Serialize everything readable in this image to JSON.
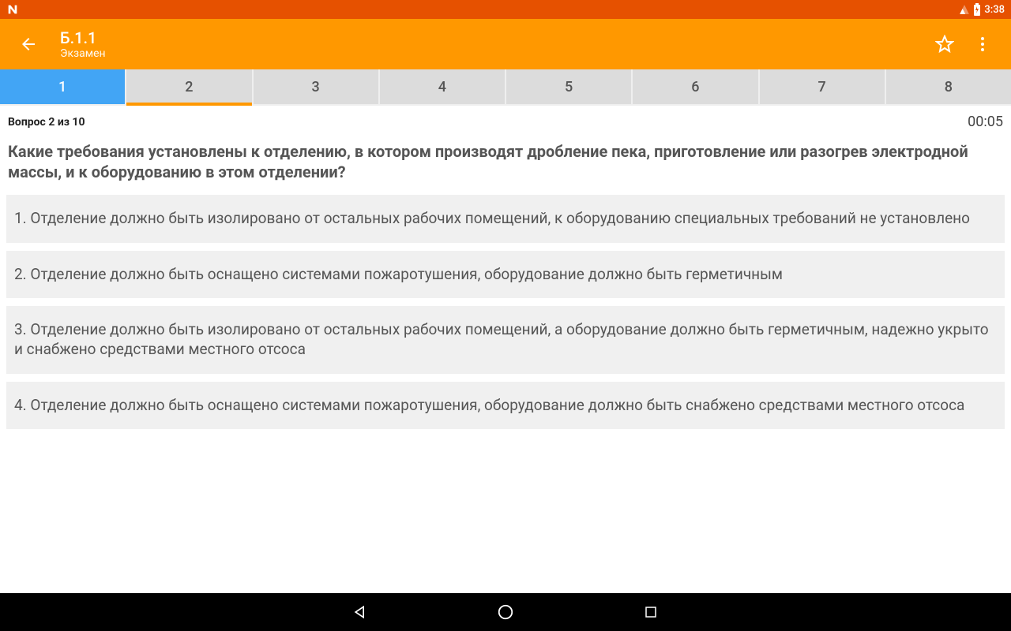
{
  "status": {
    "clock": "3:38"
  },
  "appbar": {
    "title": "Б.1.1",
    "subtitle": "Экзамен"
  },
  "tabs": [
    {
      "label": "1",
      "active": true,
      "current": false
    },
    {
      "label": "2",
      "active": false,
      "current": true
    },
    {
      "label": "3",
      "active": false,
      "current": false
    },
    {
      "label": "4",
      "active": false,
      "current": false
    },
    {
      "label": "5",
      "active": false,
      "current": false
    },
    {
      "label": "6",
      "active": false,
      "current": false
    },
    {
      "label": "7",
      "active": false,
      "current": false
    },
    {
      "label": "8",
      "active": false,
      "current": false
    }
  ],
  "meta": {
    "counter": "Вопрос 2 из 10",
    "timer": "00:05"
  },
  "question": "Какие требования установлены к отделению, в котором производят дробление пека, приготовление или разогрев электродной массы, и к оборудованию в этом отделении?",
  "answers": [
    "1. Отделение должно быть изолировано от остальных рабочих помещений, к оборудованию специальных требований не установлено",
    "2. Отделение должно быть оснащено системами пожаротушения, оборудование должно быть герметичным",
    "3. Отделение должно быть изолировано от остальных рабочих помещений, а оборудование должно быть герметичным, надежно укрыто и снабжено средствами местного отсоса",
    "4. Отделение должно быть оснащено системами пожаротушения, оборудование должно быть снабжено средствами местного отсоса"
  ]
}
